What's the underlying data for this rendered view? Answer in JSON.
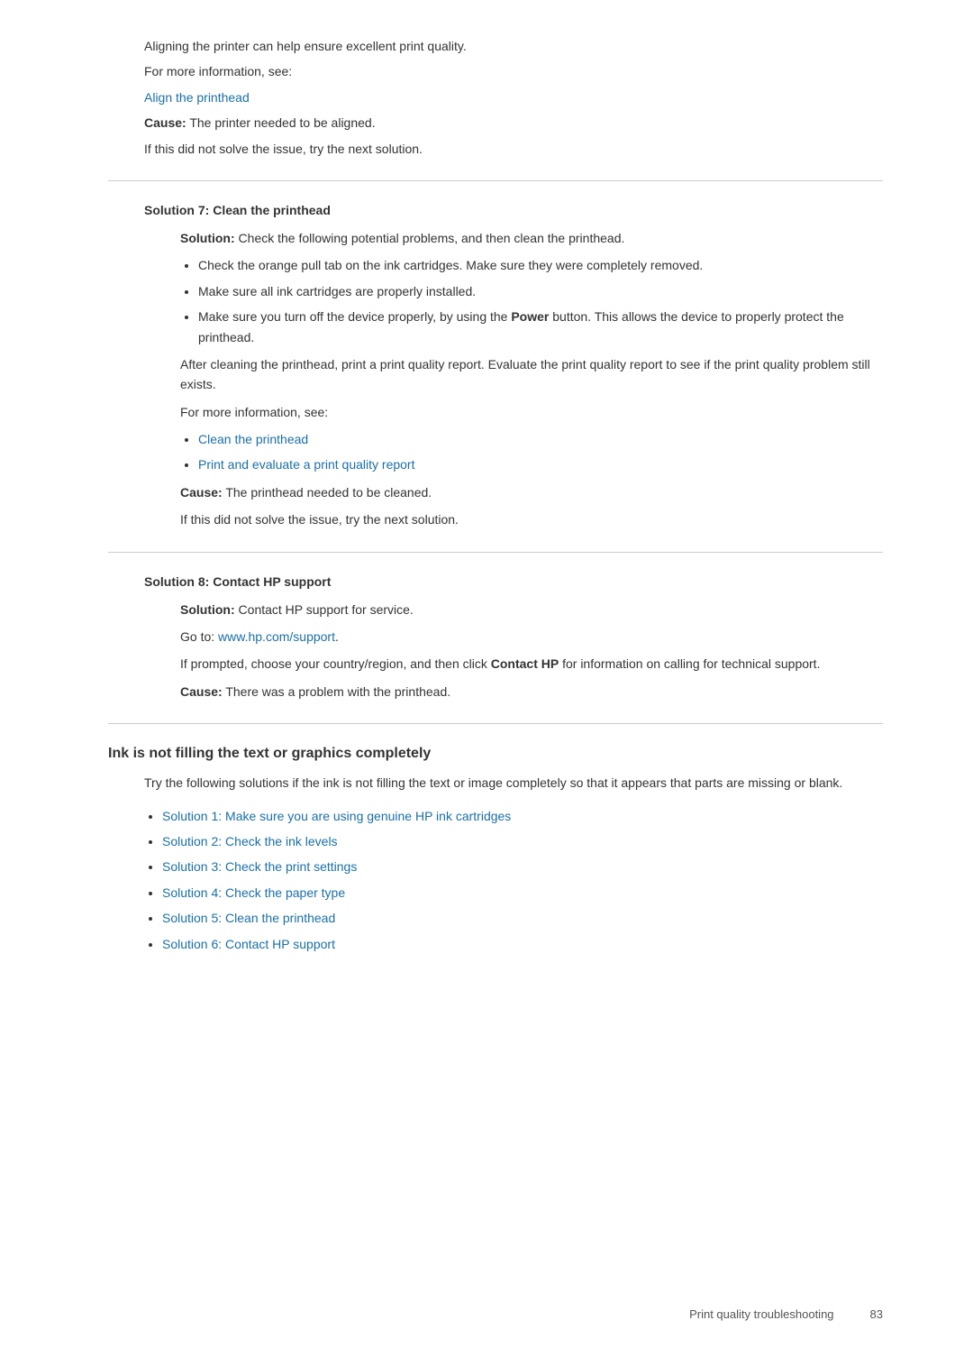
{
  "intro": {
    "line1": "Aligning the printer can help ensure excellent print quality.",
    "line2": "For more information, see:",
    "link_align_printhead": "Align the printhead",
    "cause_label": "Cause:",
    "cause_text": "  The printer needed to be aligned.",
    "next_solution": "If this did not solve the issue, try the next solution."
  },
  "solution7": {
    "title": "Solution 7: Clean the printhead",
    "solution_label": "Solution:",
    "solution_text": "  Check the following potential problems, and then clean the printhead.",
    "bullets": [
      "Check the orange pull tab on the ink cartridges. Make sure they were completely removed.",
      "Make sure all ink cartridges are properly installed.",
      "Make sure you turn off the device properly, by using the Power button. This allows the device to properly protect the printhead."
    ],
    "after_clean": "After cleaning the printhead, print a print quality report. Evaluate the print quality report to see if the print quality problem still exists.",
    "for_more": "For more information, see:",
    "link1": "Clean the printhead",
    "link2": "Print and evaluate a print quality report",
    "cause_label": "Cause:",
    "cause_text": "  The printhead needed to be cleaned.",
    "next_solution": "If this did not solve the issue, try the next solution."
  },
  "solution8": {
    "title": "Solution 8: Contact HP support",
    "solution_label": "Solution:",
    "solution_text": "  Contact HP support for service.",
    "goto": "Go to: ",
    "link_hp": "www.hp.com/support",
    "link_hp_url": "www.hp.com/support",
    "goto_period": ".",
    "if_prompted_pre": "If prompted, choose your country/region, and then click ",
    "contact_hp_bold": "Contact HP",
    "if_prompted_post": " for information on calling for technical support.",
    "cause_label": "Cause:",
    "cause_text": "  There was a problem with the printhead."
  },
  "ink_section": {
    "heading": "Ink is not filling the text or graphics completely",
    "intro": "Try the following solutions if the ink is not filling the text or image completely so that it appears that parts are missing or blank.",
    "solutions": [
      "Solution 1: Make sure you are using genuine HP ink cartridges",
      "Solution 2: Check the ink levels",
      "Solution 3: Check the print settings",
      "Solution 4: Check the paper type",
      "Solution 5: Clean the printhead",
      "Solution 6: Contact HP support"
    ]
  },
  "footer": {
    "left": "Print quality troubleshooting",
    "right": "83"
  }
}
